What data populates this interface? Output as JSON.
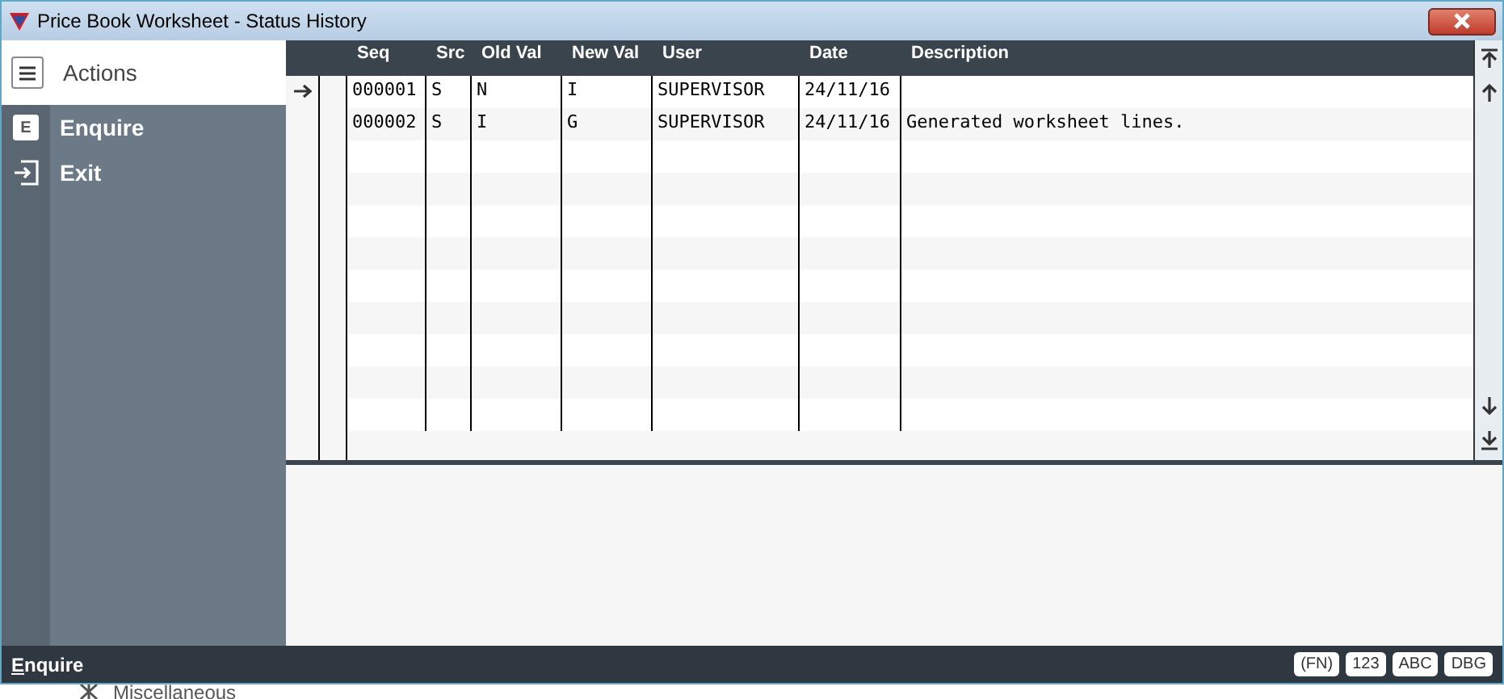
{
  "window": {
    "title": "Price Book Worksheet - Status History"
  },
  "sidebar": {
    "title": "Actions",
    "items": [
      {
        "key": "E",
        "label": "Enquire",
        "kind": "letter"
      },
      {
        "label": "Exit",
        "kind": "exit"
      }
    ]
  },
  "table": {
    "columns": [
      "Seq",
      "Src",
      "Old Val",
      "New Val",
      "User",
      "Date",
      "Description"
    ],
    "rows": [
      {
        "selected": true,
        "cells": [
          "000001",
          "S",
          "N",
          "I",
          "SUPERVISOR",
          "24/11/16",
          ""
        ]
      },
      {
        "selected": false,
        "cells": [
          "000002",
          "S",
          "I",
          "G",
          "SUPERVISOR",
          "24/11/16",
          "Generated worksheet lines."
        ]
      }
    ]
  },
  "status_bar": {
    "text": "Enquire",
    "badges": [
      "(FN)",
      "123",
      "ABC",
      "DBG"
    ]
  },
  "background": {
    "label": "Miscellaneous"
  }
}
